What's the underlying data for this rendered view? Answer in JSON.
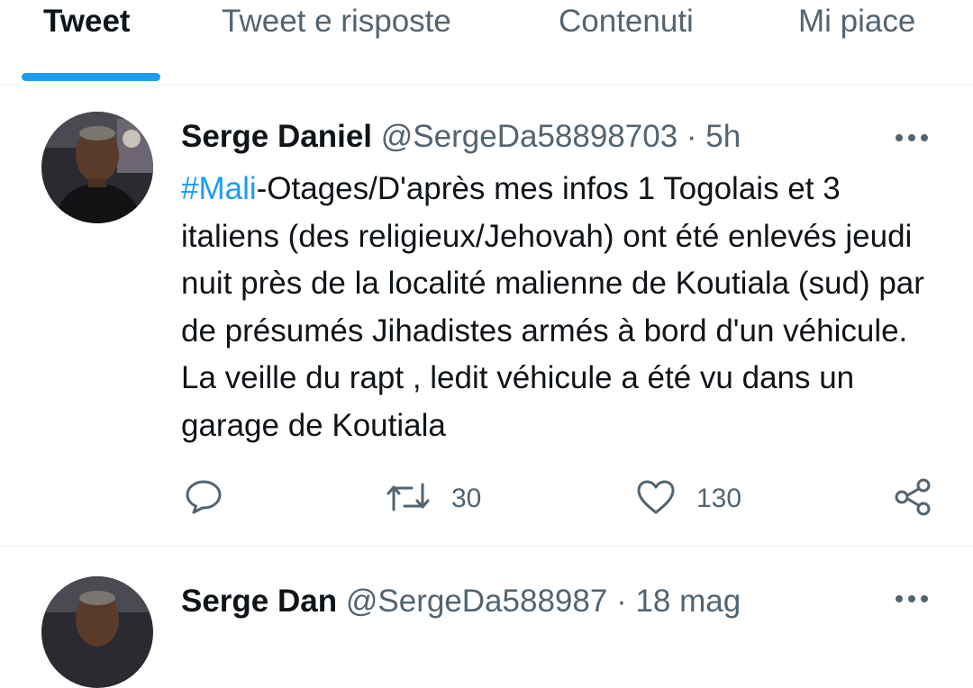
{
  "tabs": [
    {
      "label": "Tweet",
      "active": true
    },
    {
      "label": "Tweet e risposte",
      "active": false
    },
    {
      "label": "Contenuti",
      "active": false
    },
    {
      "label": "Mi piace",
      "active": false
    }
  ],
  "tweets": [
    {
      "name": "Serge Daniel",
      "handle": "@SergeDa58898703",
      "sep": "·",
      "time": "5h",
      "hashtag": "#Mali",
      "text": "-Otages/D'après mes infos 1 Togolais et 3 italiens (des religieux/Jehovah) ont été enlevés jeudi nuit près de la localité malienne de Koutiala (sud) par de présumés Jihadistes armés à bord d'un véhicule. La veille du rapt , ledit véhicule a été vu dans un garage de Koutiala",
      "retweets": "30",
      "likes": "130"
    },
    {
      "name": "Serge Dan",
      "handle": "@SergeDa588987",
      "sep": "·",
      "time": "18 mag"
    }
  ],
  "colors": {
    "accent": "#1d9bf0",
    "secondary_text": "#536471",
    "divider": "#eff3f4"
  },
  "icons": [
    "reply-icon",
    "retweet-icon",
    "like-icon",
    "share-icon",
    "more-icon"
  ]
}
